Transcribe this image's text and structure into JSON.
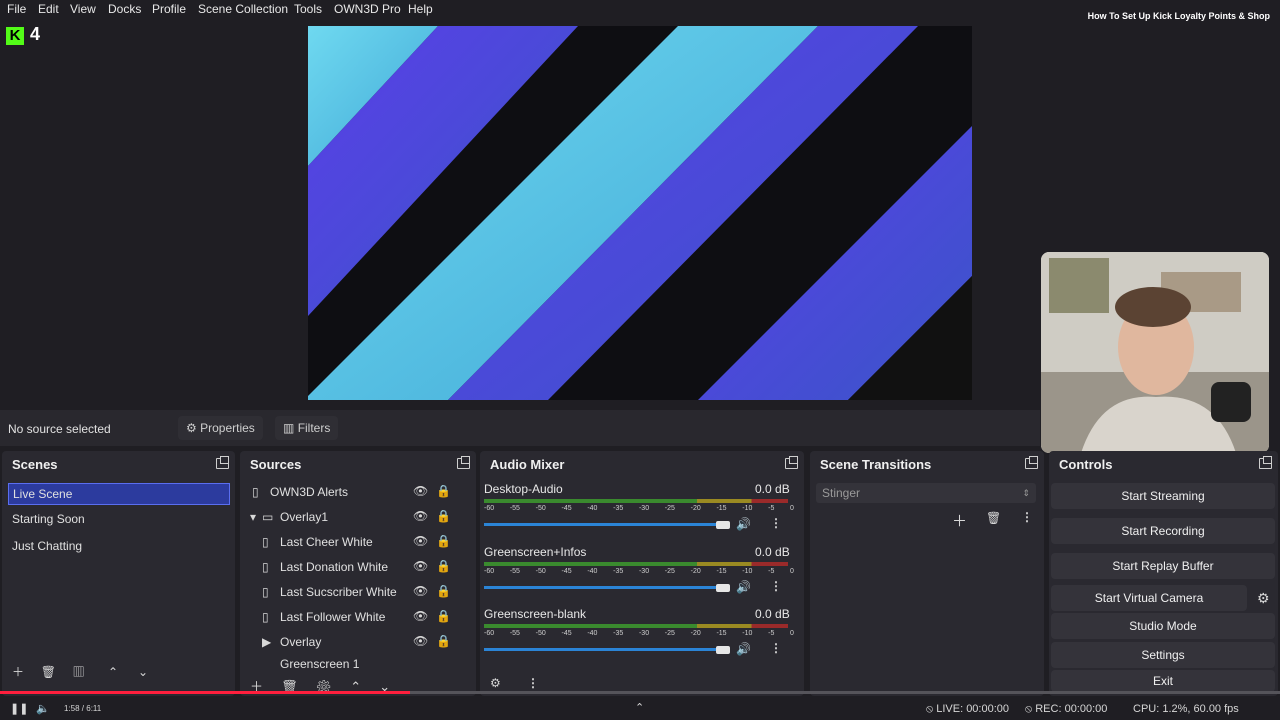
{
  "menu": {
    "items": [
      "File",
      "Edit",
      "View",
      "Docks",
      "Profile",
      "Scene Collection",
      "Tools",
      "OWN3D Pro",
      "Help"
    ]
  },
  "video_title": "How To Set Up Kick Loyalty Points & Shop",
  "kick": {
    "logo": "K",
    "count": "4"
  },
  "source_bar": {
    "status": "No source selected",
    "properties": "Properties",
    "filters": "Filters"
  },
  "scenes": {
    "title": "Scenes",
    "items": [
      "Live Scene",
      "Starting Soon",
      "Just Chatting"
    ]
  },
  "sources": {
    "title": "Sources",
    "items": [
      "OWN3D Alerts",
      "Overlay1",
      "Last Cheer White",
      "Last Donation White",
      "Last Sucscriber White",
      "Last Follower White",
      "Overlay",
      "Greenscreen 1"
    ]
  },
  "audio_mixer": {
    "title": "Audio Mixer",
    "channels": [
      {
        "name": "Desktop-Audio",
        "db": "0.0 dB"
      },
      {
        "name": "Greenscreen+Infos",
        "db": "0.0 dB"
      },
      {
        "name": "Greenscreen-blank",
        "db": "0.0 dB"
      }
    ],
    "ticks": [
      "-60",
      "-55",
      "-50",
      "-45",
      "-40",
      "-35",
      "-30",
      "-25",
      "-20",
      "-15",
      "-10",
      "-5",
      "0"
    ]
  },
  "transitions": {
    "title": "Scene Transitions",
    "selected": "Stinger"
  },
  "controls": {
    "title": "Controls",
    "buttons": [
      "Start Streaming",
      "Start Recording",
      "Start Replay Buffer",
      "Start Virtual Camera",
      "Studio Mode",
      "Settings",
      "Exit"
    ]
  },
  "status": {
    "live": "LIVE: 00:00:00",
    "rec": "REC: 00:00:00",
    "cpu": "CPU: 1.2%, 60.00 fps"
  },
  "player": {
    "time": "1:58 / 6:11",
    "progress": 0.32
  },
  "colors": {
    "accent": "#2c3b9e",
    "kick_green": "#53fc18",
    "progress_red": "#ff1f3d"
  }
}
